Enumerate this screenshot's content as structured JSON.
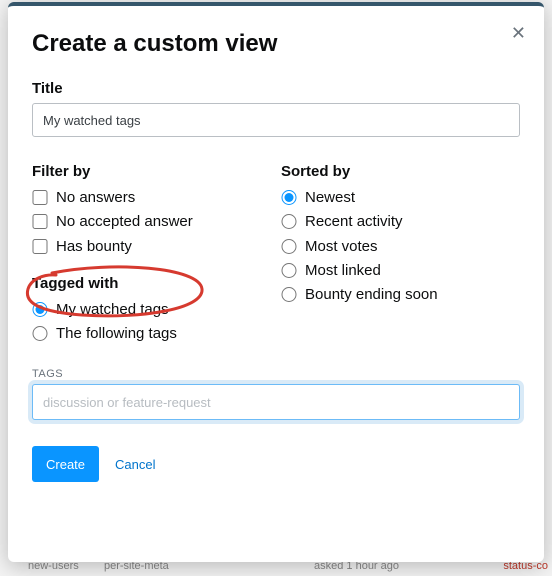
{
  "modal": {
    "heading": "Create a custom view",
    "title_label": "Title",
    "title_value": "My watched tags",
    "filter": {
      "heading": "Filter by",
      "options": [
        "No answers",
        "No accepted answer",
        "Has bounty"
      ]
    },
    "sort": {
      "heading": "Sorted by",
      "options": [
        "Newest",
        "Recent activity",
        "Most votes",
        "Most linked",
        "Bounty ending soon"
      ],
      "selected": "Newest"
    },
    "tagged": {
      "heading": "Tagged with",
      "options": [
        "My watched tags",
        "The following tags"
      ],
      "selected": "My watched tags"
    },
    "tags_field": {
      "label": "TAGS",
      "placeholder": "discussion or feature-request"
    },
    "actions": {
      "create": "Create",
      "cancel": "Cancel"
    }
  },
  "bg_fragments": {
    "a": "new-users",
    "b": "per-site-meta",
    "c": "asked 1 hour ago",
    "d": "status-co"
  }
}
